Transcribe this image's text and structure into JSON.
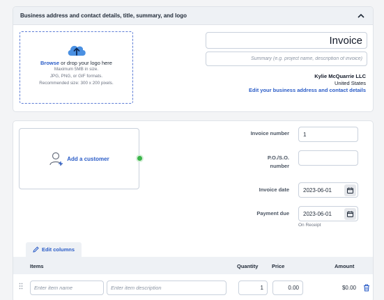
{
  "header": {
    "title": "Business address and contact details, title, summary, and logo"
  },
  "logo": {
    "browse": "Browse",
    "drop_text": " or drop your logo here",
    "max_size": "Maximum 5MB in size.",
    "formats": "JPG, PNG, or GIF formats.",
    "recommended": "Recommended size: 300 x 200 pixels."
  },
  "invoice": {
    "title_value": "Invoice",
    "summary_placeholder": "Summary (e.g. project name, description of invoice)"
  },
  "business": {
    "name": "Kylie McQuarrie LLC",
    "country": "United States",
    "edit_link": "Edit your business address and contact details"
  },
  "customer": {
    "add_label": "Add a customer"
  },
  "fields": {
    "invoice_number_label": "Invoice number",
    "invoice_number_value": "1",
    "po_label_line1": "P.O./S.O.",
    "po_label_line2": "number",
    "po_value": "",
    "invoice_date_label": "Invoice date",
    "invoice_date_value": "2023-06-01",
    "payment_due_label": "Payment due",
    "payment_due_value": "2023-06-01",
    "payment_due_note": "On Receipt"
  },
  "items": {
    "edit_columns": "Edit columns",
    "col_items": "Items",
    "col_quantity": "Quantity",
    "col_price": "Price",
    "col_amount": "Amount",
    "rows": [
      {
        "name_placeholder": "Enter item name",
        "desc_placeholder": "Enter item description",
        "quantity": "1",
        "price": "0.00",
        "amount": "$0.00"
      }
    ]
  },
  "colors": {
    "accent": "#2a5cc7",
    "status_dot": "#3bb54a",
    "header_bg": "#eef1f5"
  }
}
